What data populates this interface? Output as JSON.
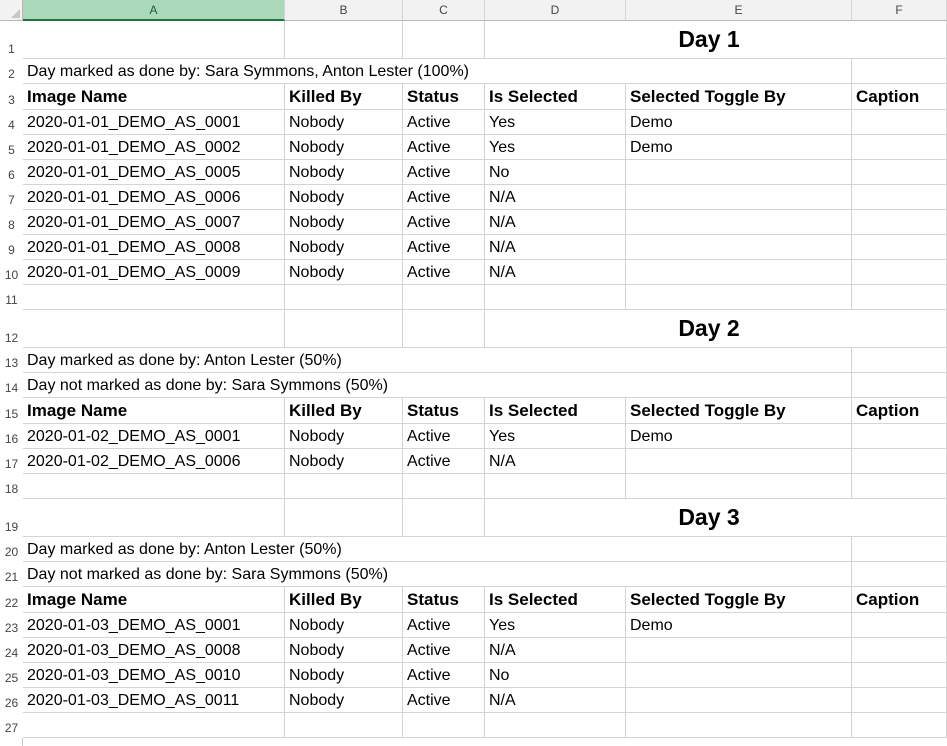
{
  "columns": [
    "A",
    "B",
    "C",
    "D",
    "E",
    "F"
  ],
  "selected_column": "A",
  "table_headers": [
    "Image Name",
    "Killed By",
    "Status",
    "Is Selected",
    "Selected Toggle By",
    "Caption"
  ],
  "rows": [
    {
      "n": "1",
      "type": "title",
      "text": "Day 1"
    },
    {
      "n": "2",
      "type": "note",
      "text": "Day marked as done by: Sara Symmons, Anton Lester (100%)"
    },
    {
      "n": "3",
      "type": "header"
    },
    {
      "n": "4",
      "type": "data",
      "cells": [
        "2020-01-01_DEMO_AS_0001",
        "Nobody",
        "Active",
        "Yes",
        "Demo",
        ""
      ]
    },
    {
      "n": "5",
      "type": "data",
      "cells": [
        "2020-01-01_DEMO_AS_0002",
        "Nobody",
        "Active",
        "Yes",
        "Demo",
        ""
      ]
    },
    {
      "n": "6",
      "type": "data",
      "cells": [
        "2020-01-01_DEMO_AS_0005",
        "Nobody",
        "Active",
        "No",
        "",
        ""
      ]
    },
    {
      "n": "7",
      "type": "data",
      "cells": [
        "2020-01-01_DEMO_AS_0006",
        "Nobody",
        "Active",
        "N/A",
        "",
        ""
      ]
    },
    {
      "n": "8",
      "type": "data",
      "cells": [
        "2020-01-01_DEMO_AS_0007",
        "Nobody",
        "Active",
        "N/A",
        "",
        ""
      ]
    },
    {
      "n": "9",
      "type": "data",
      "cells": [
        "2020-01-01_DEMO_AS_0008",
        "Nobody",
        "Active",
        "N/A",
        "",
        ""
      ]
    },
    {
      "n": "10",
      "type": "data",
      "cells": [
        "2020-01-01_DEMO_AS_0009",
        "Nobody",
        "Active",
        "N/A",
        "",
        ""
      ]
    },
    {
      "n": "11",
      "type": "empty"
    },
    {
      "n": "12",
      "type": "title",
      "text": "Day 2"
    },
    {
      "n": "13",
      "type": "note",
      "text": "Day marked as done by: Anton Lester (50%)"
    },
    {
      "n": "14",
      "type": "note",
      "text": "Day not marked as done by: Sara Symmons (50%)"
    },
    {
      "n": "15",
      "type": "header"
    },
    {
      "n": "16",
      "type": "data",
      "cells": [
        "2020-01-02_DEMO_AS_0001",
        "Nobody",
        "Active",
        "Yes",
        "Demo",
        ""
      ]
    },
    {
      "n": "17",
      "type": "data",
      "cells": [
        "2020-01-02_DEMO_AS_0006",
        "Nobody",
        "Active",
        "N/A",
        "",
        ""
      ]
    },
    {
      "n": "18",
      "type": "empty"
    },
    {
      "n": "19",
      "type": "title",
      "text": "Day 3"
    },
    {
      "n": "20",
      "type": "note",
      "text": "Day marked as done by: Anton Lester (50%)"
    },
    {
      "n": "21",
      "type": "note",
      "text": "Day not marked as done by: Sara Symmons (50%)"
    },
    {
      "n": "22",
      "type": "header"
    },
    {
      "n": "23",
      "type": "data",
      "cells": [
        "2020-01-03_DEMO_AS_0001",
        "Nobody",
        "Active",
        "Yes",
        "Demo",
        ""
      ]
    },
    {
      "n": "24",
      "type": "data",
      "cells": [
        "2020-01-03_DEMO_AS_0008",
        "Nobody",
        "Active",
        "N/A",
        "",
        ""
      ]
    },
    {
      "n": "25",
      "type": "data",
      "cells": [
        "2020-01-03_DEMO_AS_0010",
        "Nobody",
        "Active",
        "No",
        "",
        ""
      ]
    },
    {
      "n": "26",
      "type": "data",
      "cells": [
        "2020-01-03_DEMO_AS_0011",
        "Nobody",
        "Active",
        "N/A",
        "",
        ""
      ]
    },
    {
      "n": "27",
      "type": "empty"
    }
  ]
}
